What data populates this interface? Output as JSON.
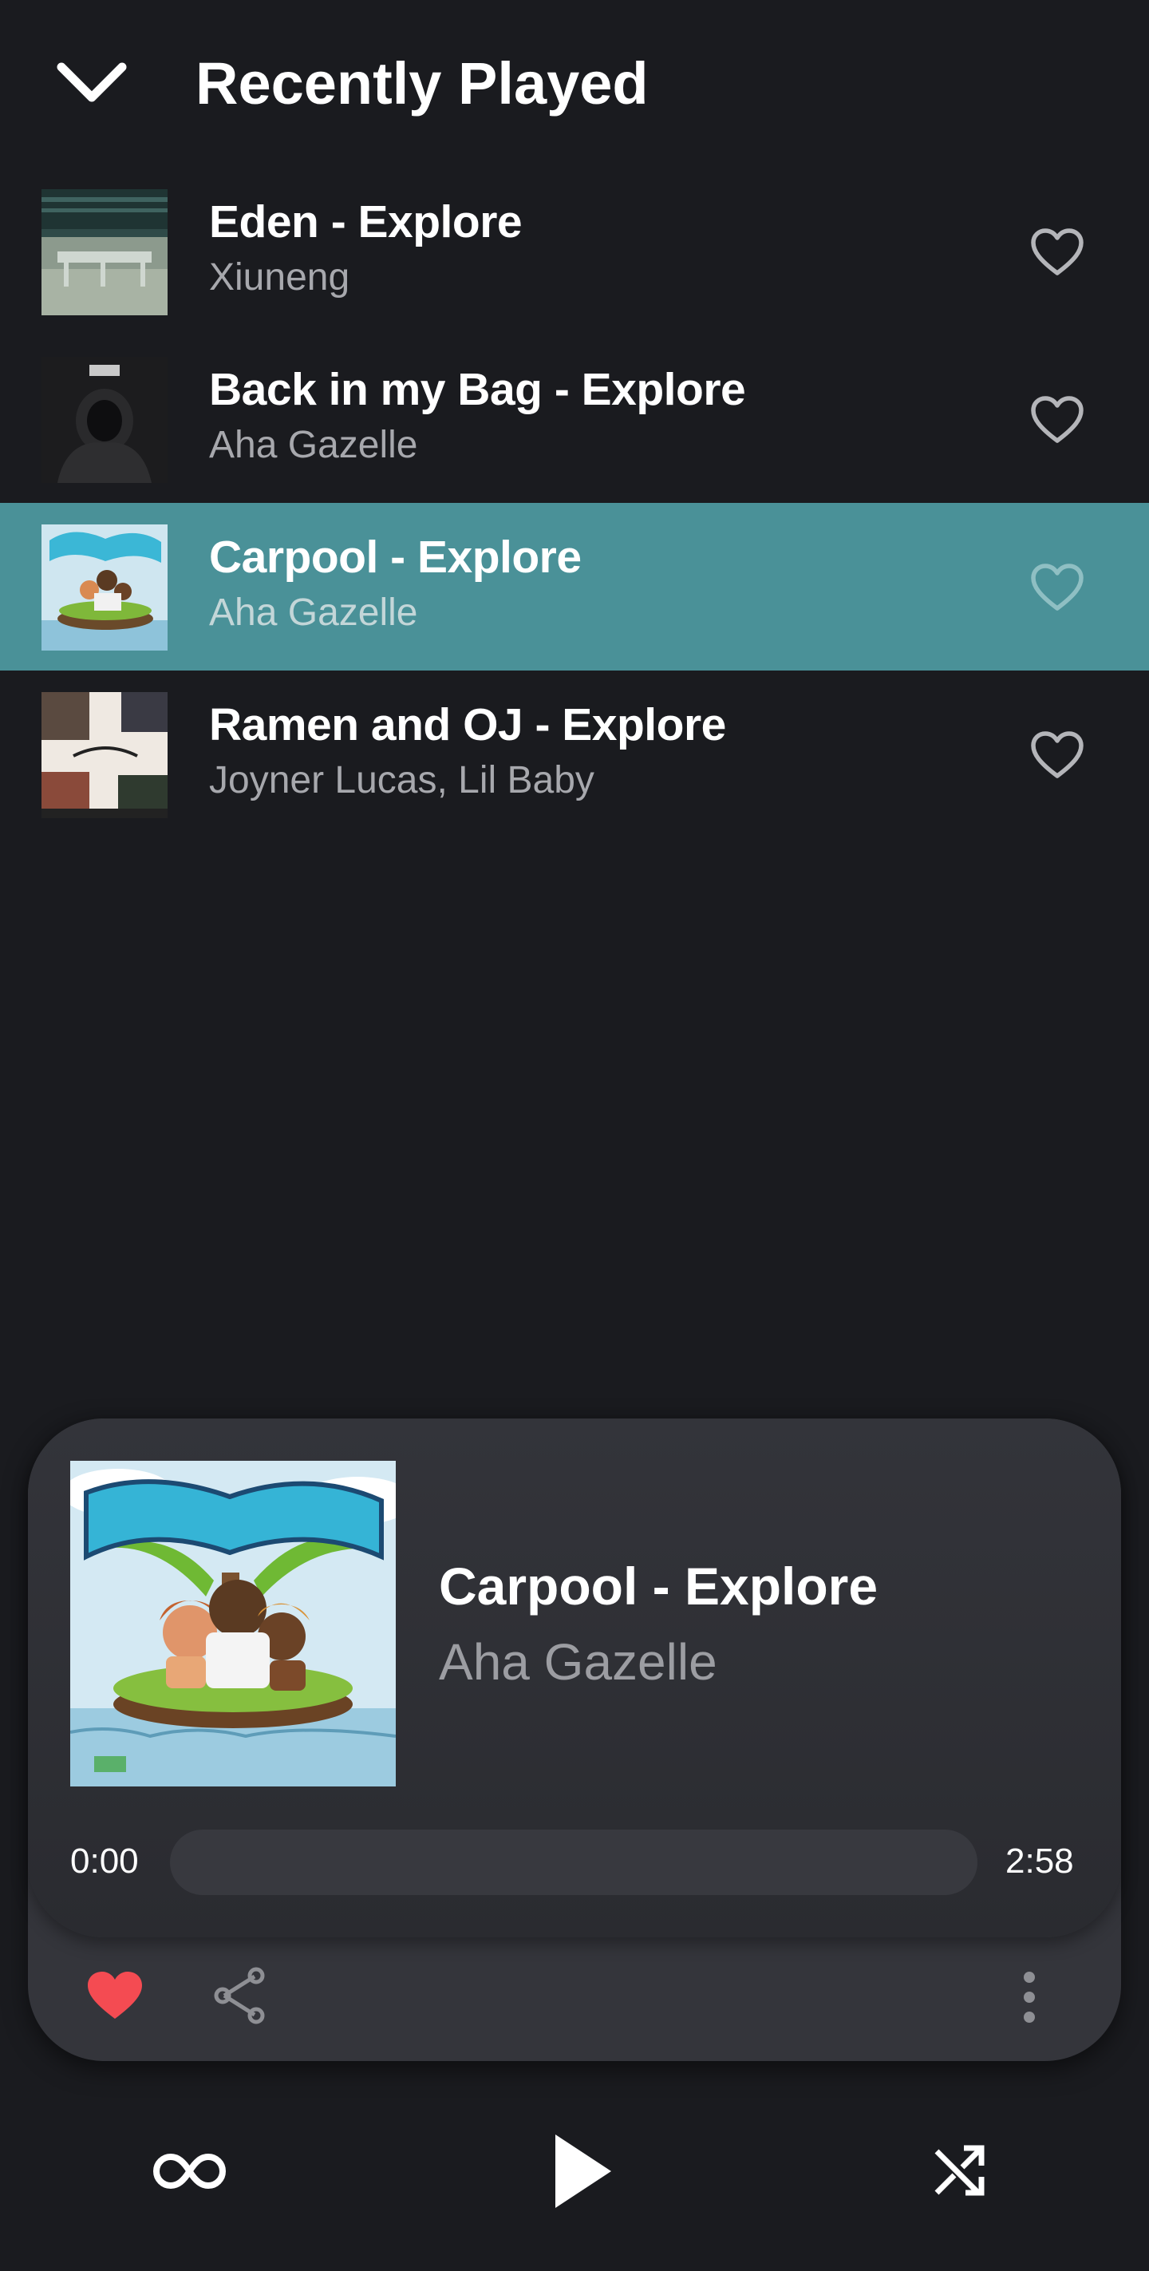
{
  "header": {
    "title": "Recently Played",
    "back_icon": "chevron-down-icon"
  },
  "tracks": [
    {
      "title": "Eden - Explore",
      "artist": "Xiuneng",
      "favorite": false,
      "active": false
    },
    {
      "title": "Back in my Bag - Explore",
      "artist": "Aha Gazelle",
      "favorite": false,
      "active": false
    },
    {
      "title": "Carpool - Explore",
      "artist": "Aha Gazelle",
      "favorite": false,
      "active": true
    },
    {
      "title": "Ramen and OJ - Explore",
      "artist": "Joyner Lucas, Lil Baby",
      "favorite": false,
      "active": false
    }
  ],
  "now_playing": {
    "title": "Carpool - Explore",
    "artist": "Aha Gazelle",
    "elapsed": "0:00",
    "duration": "2:58",
    "progress": 0,
    "favorite": true
  },
  "colors": {
    "background": "#1a1b1f",
    "active_row": "#4a9198",
    "card": "#34353b",
    "favorite_red": "#f44b52",
    "secondary_text": "#a7a8ad"
  },
  "icons": {
    "heart_outline": "heart-outline-icon",
    "heart_filled": "heart-filled-icon",
    "share": "share-icon",
    "more": "more-vertical-icon",
    "repeat": "repeat-icon",
    "play": "play-icon",
    "shuffle": "shuffle-icon"
  }
}
